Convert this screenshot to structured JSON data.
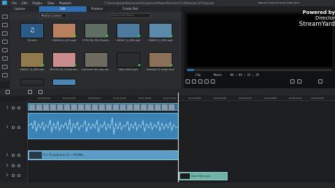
{
  "menubar": {
    "items": [
      "File",
      "Edit",
      "Plugins",
      "View",
      "Playback"
    ],
    "file_path": "C:\\Users\\graph\\Documents\\CyberLink\\PowerDirector\\17.0\\Podcast 32 Final.pds",
    "notice": "Welcome! View all tutorial videos here!"
  },
  "tabs": [
    "Capture",
    "Edit",
    "Produce",
    "Create Disc"
  ],
  "library": {
    "dropdown": "Media Content",
    "search_placeholder": "Search the library",
    "items": [
      {
        "caption": "32.m4a",
        "kind": "audio"
      },
      {
        "caption": "160405_A_022.mp4",
        "kind": "video"
      },
      {
        "caption": "1732108_762_Muella...",
        "kind": "video"
      },
      {
        "caption": "160407_A_056.mp4",
        "kind": "video"
      },
      {
        "caption": "160807_A_059.mp4",
        "kind": "video"
      },
      {
        "caption": "160807_A_026.mp4",
        "kind": "video"
      },
      {
        "caption": "181125_04_Christmas...",
        "kind": "video"
      },
      {
        "caption": "hat leave the play sta...",
        "kind": "video"
      },
      {
        "caption": "New video.mp4",
        "kind": "video"
      },
      {
        "caption": "Podcast 32 rough.mp4",
        "kind": "video"
      }
    ]
  },
  "preview": {
    "clip_tab": "Clip",
    "movie_tab": "Movie",
    "timecode": "00 ; 04 ; 33 ; 29",
    "overlay": {
      "powered_by": "Powered by",
      "director": "Director",
      "brand": "StreamYard"
    }
  },
  "ruler": {
    "ticks": [
      "00;00;00;00",
      "00;00;16;00",
      "00;00;50;00",
      "00;01;24;00",
      "00;01;48;00",
      "00;02;12;00",
      "00;02;36;00",
      "00;03;00;00",
      "00;03;24;00",
      "00;03;48;00",
      "00;04;12;00",
      "00;04;35;00"
    ]
  },
  "tracks": {
    "numbers": [
      "1",
      "1",
      "2",
      "2",
      "3"
    ],
    "text_clip_label": "fl 1.75 wybrane 23 ~ M.MMe",
    "small_clip_label": "New video.mp4"
  },
  "colors": {
    "accent": "#2f6fb0",
    "clip_video": "#3a6d8a",
    "clip_audio": "#3b83b4"
  }
}
